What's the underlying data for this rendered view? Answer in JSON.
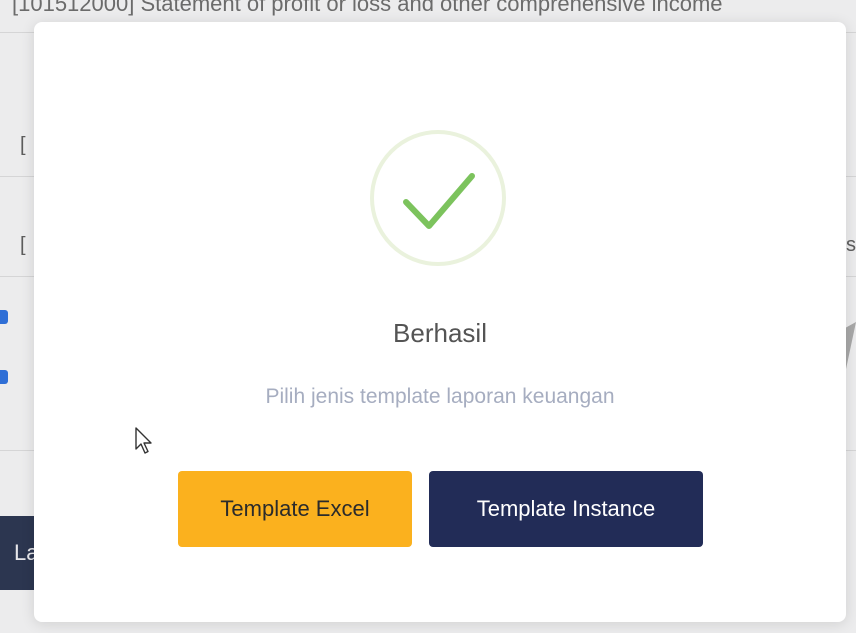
{
  "background": {
    "header_text": "[101512000] Statement of profit or loss and other comprehensive income",
    "row_bracket": "[",
    "row_bracket_right": "s",
    "sidebar_button_label": "La"
  },
  "modal": {
    "icon": "checkmark-icon",
    "title": "Berhasil",
    "text": "Pilih jenis template laporan keuangan",
    "buttons": {
      "excel_label": "Template Excel",
      "instance_label": "Template Instance"
    }
  },
  "colors": {
    "success_green": "#7cc35d",
    "excel_button": "#fbb11e",
    "instance_button": "#222c57",
    "modal_text": "#a6adc0"
  }
}
